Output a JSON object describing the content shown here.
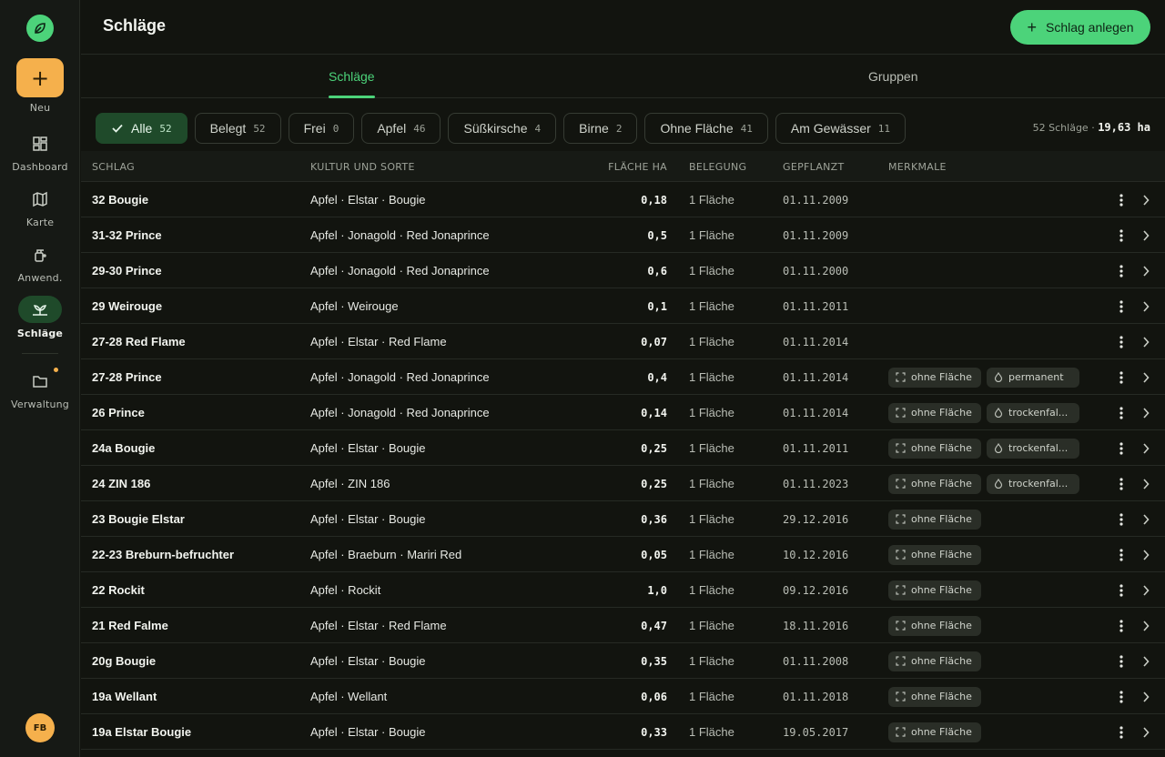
{
  "sidebar": {
    "new_label": "Neu",
    "items": [
      {
        "label": "Dashboard",
        "icon": "dashboard-icon"
      },
      {
        "label": "Karte",
        "icon": "map-icon"
      },
      {
        "label": "Anwend.",
        "icon": "sprayer-icon"
      },
      {
        "label": "Schläge",
        "icon": "plant-icon",
        "active": true
      },
      {
        "label": "Verwaltung",
        "icon": "folder-icon"
      }
    ],
    "avatar_initials": "FB"
  },
  "header": {
    "title": "Schläge",
    "create_button": "Schlag anlegen"
  },
  "tabs": [
    {
      "label": "Schläge",
      "active": true
    },
    {
      "label": "Gruppen",
      "active": false
    }
  ],
  "filters": [
    {
      "label": "Alle",
      "count": "52",
      "active": true
    },
    {
      "label": "Belegt",
      "count": "52"
    },
    {
      "label": "Frei",
      "count": "0"
    },
    {
      "label": "Apfel",
      "count": "46"
    },
    {
      "label": "Süßkirsche",
      "count": "4"
    },
    {
      "label": "Birne",
      "count": "2"
    },
    {
      "label": "Ohne Fläche",
      "count": "41"
    },
    {
      "label": "Am Gewässer",
      "count": "11"
    }
  ],
  "summary": {
    "count_text": "52 Schläge · ",
    "area_text": "19,63 ha"
  },
  "table": {
    "headers": {
      "schlag": "SCHLAG",
      "kultur": "KULTUR UND SORTE",
      "flaeche": "FLÄCHE HA",
      "belegung": "BELEGUNG",
      "gepflanzt": "GEPFLANZT",
      "merkmale": "MERKMALE"
    },
    "rows": [
      {
        "name": "32 Bougie",
        "kultur": "Apfel · Elstar · Bougie",
        "area": "0,18",
        "belegung": "1 Fläche",
        "date": "01.11.2009",
        "tags": []
      },
      {
        "name": "31-32 Prince",
        "kultur": "Apfel · Jonagold · Red Jonaprince",
        "area": "0,5",
        "belegung": "1 Fläche",
        "date": "01.11.2009",
        "tags": []
      },
      {
        "name": "29-30 Prince",
        "kultur": "Apfel · Jonagold · Red Jonaprince",
        "area": "0,6",
        "belegung": "1 Fläche",
        "date": "01.11.2000",
        "tags": []
      },
      {
        "name": "29 Weirouge",
        "kultur": "Apfel · Weirouge",
        "area": "0,1",
        "belegung": "1 Fläche",
        "date": "01.11.2011",
        "tags": []
      },
      {
        "name": "27-28 Red Flame",
        "kultur": "Apfel · Elstar · Red Flame",
        "area": "0,07",
        "belegung": "1 Fläche",
        "date": "01.11.2014",
        "tags": []
      },
      {
        "name": "27-28 Prince",
        "kultur": "Apfel · Jonagold · Red Jonaprince",
        "area": "0,4",
        "belegung": "1 Fläche",
        "date": "01.11.2014",
        "tags": [
          "ohne Fläche",
          "permanent"
        ]
      },
      {
        "name": "26 Prince",
        "kultur": "Apfel · Jonagold · Red Jonaprince",
        "area": "0,14",
        "belegung": "1 Fläche",
        "date": "01.11.2014",
        "tags": [
          "ohne Fläche",
          "trockenfal..."
        ]
      },
      {
        "name": "24a Bougie",
        "kultur": "Apfel · Elstar · Bougie",
        "area": "0,25",
        "belegung": "1 Fläche",
        "date": "01.11.2011",
        "tags": [
          "ohne Fläche",
          "trockenfal..."
        ]
      },
      {
        "name": "24 ZIN 186",
        "kultur": "Apfel · ZIN 186",
        "area": "0,25",
        "belegung": "1 Fläche",
        "date": "01.11.2023",
        "tags": [
          "ohne Fläche",
          "trockenfal..."
        ]
      },
      {
        "name": "23 Bougie Elstar",
        "kultur": "Apfel · Elstar · Bougie",
        "area": "0,36",
        "belegung": "1 Fläche",
        "date": "29.12.2016",
        "tags": [
          "ohne Fläche"
        ]
      },
      {
        "name": "22-23 Breburn-befruchter",
        "kultur": "Apfel · Braeburn · Mariri Red",
        "area": "0,05",
        "belegung": "1 Fläche",
        "date": "10.12.2016",
        "tags": [
          "ohne Fläche"
        ]
      },
      {
        "name": "22 Rockit",
        "kultur": "Apfel · Rockit",
        "area": "1,0",
        "belegung": "1 Fläche",
        "date": "09.12.2016",
        "tags": [
          "ohne Fläche"
        ]
      },
      {
        "name": "21 Red Falme",
        "kultur": "Apfel · Elstar · Red Flame",
        "area": "0,47",
        "belegung": "1 Fläche",
        "date": "18.11.2016",
        "tags": [
          "ohne Fläche"
        ]
      },
      {
        "name": "20g Bougie",
        "kultur": "Apfel · Elstar · Bougie",
        "area": "0,35",
        "belegung": "1 Fläche",
        "date": "01.11.2008",
        "tags": [
          "ohne Fläche"
        ]
      },
      {
        "name": "19a Wellant",
        "kultur": "Apfel · Wellant",
        "area": "0,06",
        "belegung": "1 Fläche",
        "date": "01.11.2018",
        "tags": [
          "ohne Fläche"
        ]
      },
      {
        "name": "19a Elstar Bougie",
        "kultur": "Apfel · Elstar · Bougie",
        "area": "0,33",
        "belegung": "1 Fläche",
        "date": "19.05.2017",
        "tags": [
          "ohne Fläche"
        ]
      }
    ]
  },
  "colors": {
    "accent": "#4cd37a",
    "new_button": "#f5b04c",
    "background": "#12140f"
  }
}
